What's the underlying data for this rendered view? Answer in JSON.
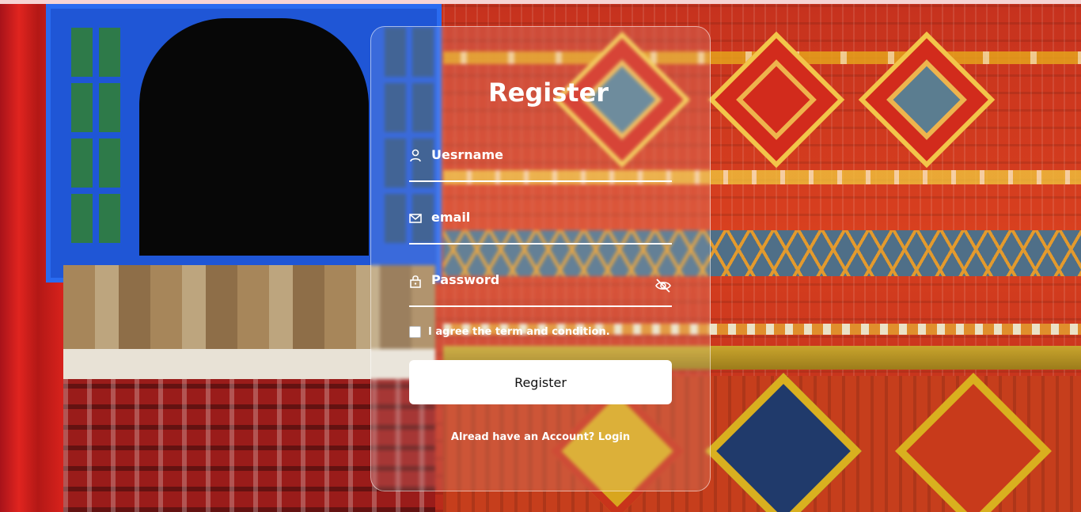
{
  "form": {
    "title": "Register",
    "fields": [
      {
        "label": "Uesrname",
        "icon": "user-icon"
      },
      {
        "label": "email",
        "icon": "mail-icon"
      },
      {
        "label": "Password",
        "icon": "lock-icon",
        "toggle_icon": "eye-off-icon"
      }
    ],
    "agree_text": "I agree the term and condition.",
    "agree_checked": false,
    "submit_label": "Register",
    "account_prompt": "Alread have an Account?",
    "login_link": "Login"
  },
  "colors": {
    "text": "#ffffff",
    "button_bg": "#ffffff",
    "button_text": "#111111",
    "card_border": "rgba(255,255,255,0.55)"
  }
}
